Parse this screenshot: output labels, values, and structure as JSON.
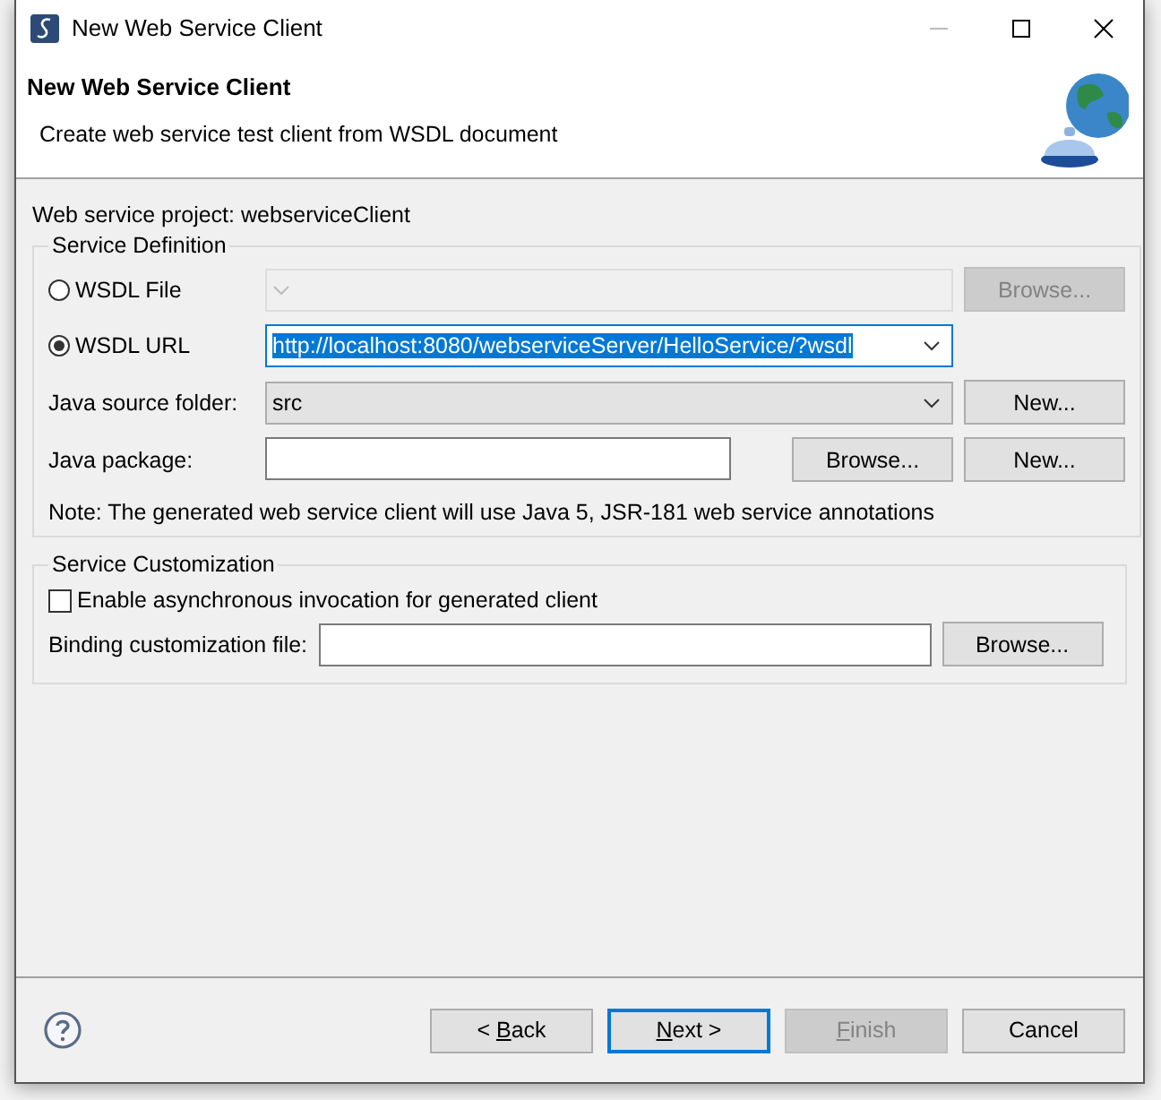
{
  "window": {
    "title": "New Web Service Client"
  },
  "header": {
    "title": "New Web Service Client",
    "description": "Create web service test client from WSDL document"
  },
  "project_label": "Web service project: webserviceClient",
  "service_definition": {
    "title": "Service Definition",
    "sources": [
      {
        "label": "WSDL File",
        "selected": false,
        "browse_button": {
          "label": "Browse...",
          "disabled": true
        }
      },
      {
        "label": "WSDL URL",
        "selected": true,
        "value": "http://localhost:8080/webserviceServer/HelloService/?wsdl",
        "value_selected": true
      }
    ],
    "source_folder": {
      "label": "Java source folder:",
      "value": "src",
      "button": "New..."
    },
    "package": {
      "label": "Java package:",
      "buttons": [
        "Browse...",
        "New..."
      ]
    },
    "note": "Note: The generated web service client will use Java 5, JSR-181 web service annotations"
  },
  "service_customization": {
    "title": "Service Customization",
    "async_checkbox": {
      "label": "Enable asynchronous invocation for generated client",
      "checked": false
    },
    "binding_file": {
      "label": "Binding customization file:",
      "button": "Browse..."
    }
  },
  "buttons": [
    {
      "label_before": "< ",
      "mnemonic": "B",
      "label_after": "ack",
      "disabled": false,
      "default": false
    },
    {
      "mnemonic": "N",
      "label_after": "ext >",
      "disabled": false,
      "default": true
    },
    {
      "mnemonic": "F",
      "label_after": "inish",
      "disabled": true,
      "default": false
    },
    {
      "label": "Cancel",
      "disabled": false,
      "default": false
    }
  ]
}
